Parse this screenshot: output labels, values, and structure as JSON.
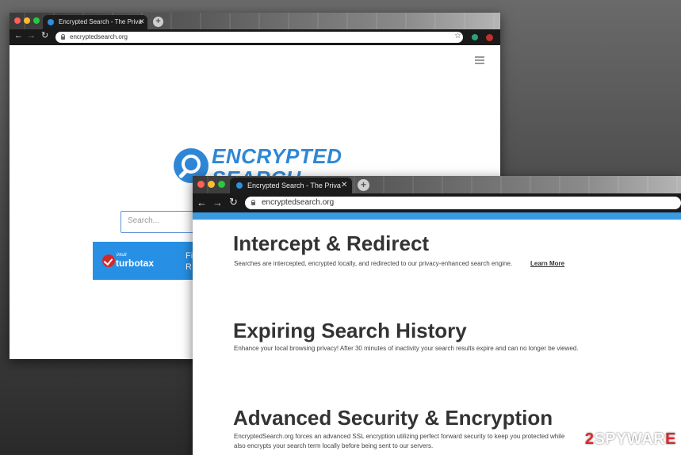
{
  "back_window": {
    "tab_title": "Encrypted Search - The Priva",
    "url": "encryptedsearch.org",
    "logo_text_line1": "ENCRYPTED",
    "logo_text_line2": "SEARCH",
    "search_placeholder": "Search...",
    "banner": {
      "brand_small": "intuit",
      "brand_name": "turbotax",
      "fragment_1": "Fi",
      "fragment_2": "R"
    }
  },
  "front_window": {
    "tab_title": "Encrypted Search - The Priva",
    "url": "encryptedsearch.org",
    "sections": [
      {
        "heading": "Intercept & Redirect",
        "text": "Searches are intercepted, encrypted locally, and redirected to our privacy-enhanced search engine.",
        "link": "Learn More"
      },
      {
        "heading": "Expiring Search History",
        "text": "Enhance your local browsing privacy! After 30 minutes of inactivity your search results expire and can no longer be viewed."
      },
      {
        "heading": "Advanced Security & Encryption",
        "text_line1": "EncryptedSearch.org forces an advanced SSL encryption utilizing perfect forward security to keep you protected while",
        "text_line2": "also encrypts your search term locally before being sent to our servers."
      }
    ]
  },
  "watermark": {
    "prefix": "2",
    "text": "SPYWAR",
    "suffix": "E"
  },
  "colors": {
    "brand_blue": "#2e87d6",
    "banner_blue": "#2790e5",
    "accent_red": "#e0262b"
  },
  "icons": [
    "traffic-lights",
    "back-arrow-icon",
    "forward-arrow-icon",
    "reload-icon",
    "lock-icon",
    "star-icon",
    "hamburger-menu-icon",
    "magnifier-logo-icon",
    "turbotax-check-icon"
  ]
}
